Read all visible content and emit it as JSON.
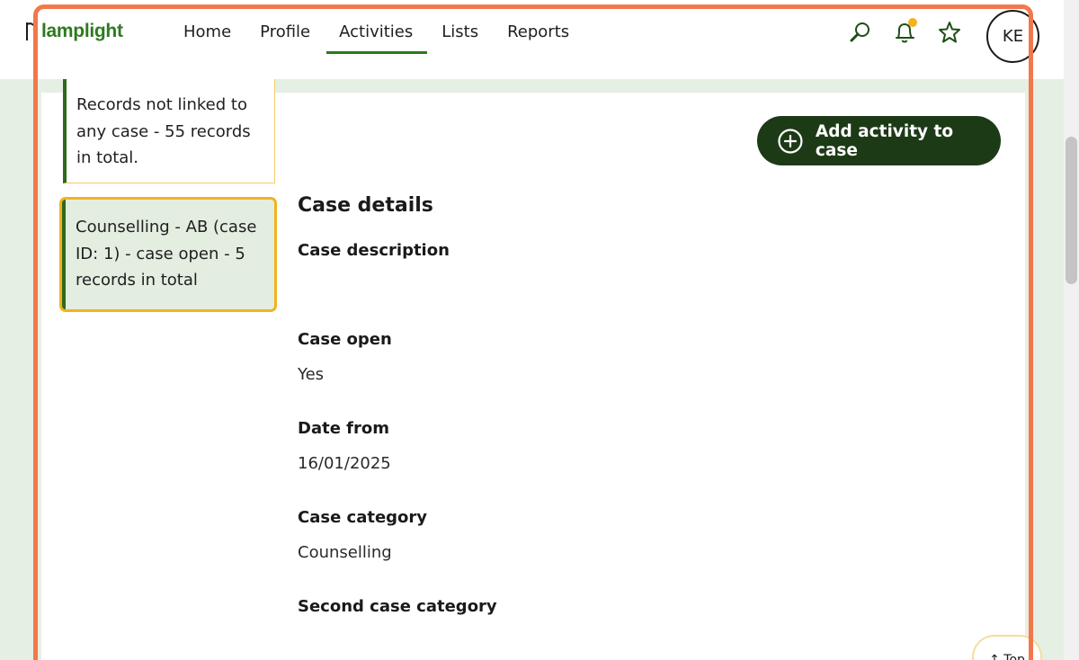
{
  "header": {
    "logo_text": "lamplight",
    "nav": [
      {
        "label": "Home",
        "active": false
      },
      {
        "label": "Profile",
        "active": false
      },
      {
        "label": "Activities",
        "active": true
      },
      {
        "label": "Lists",
        "active": false
      },
      {
        "label": "Reports",
        "active": false
      }
    ],
    "icons": [
      "search-icon",
      "bell-icon",
      "star-icon"
    ],
    "notification_dot_color": "#f2b31e",
    "avatar_initials": "KE"
  },
  "sidebar": {
    "cases": [
      {
        "label": "Records not linked to any case - 55 records in total.",
        "selected": false
      },
      {
        "label": "Counselling - AB (case ID: 1) - case open - 5 records in total",
        "selected": true
      }
    ]
  },
  "actions": {
    "add_activity_label": "Add activity to case"
  },
  "details": {
    "title": "Case details",
    "fields": [
      {
        "label": "Case description",
        "value": ""
      },
      {
        "label": "Case open",
        "value": "Yes"
      },
      {
        "label": "Date from",
        "value": "16/01/2025"
      },
      {
        "label": "Case category",
        "value": "Counselling"
      },
      {
        "label": "Second case category",
        "value": ""
      }
    ]
  },
  "top_button_label": "↑ Top",
  "colors": {
    "brand_green": "#2d7a1f",
    "dark_green": "#1d3a17",
    "accent_yellow": "#f2b31e",
    "highlight_orange": "#f2784b",
    "page_background": "#e6efe3"
  }
}
